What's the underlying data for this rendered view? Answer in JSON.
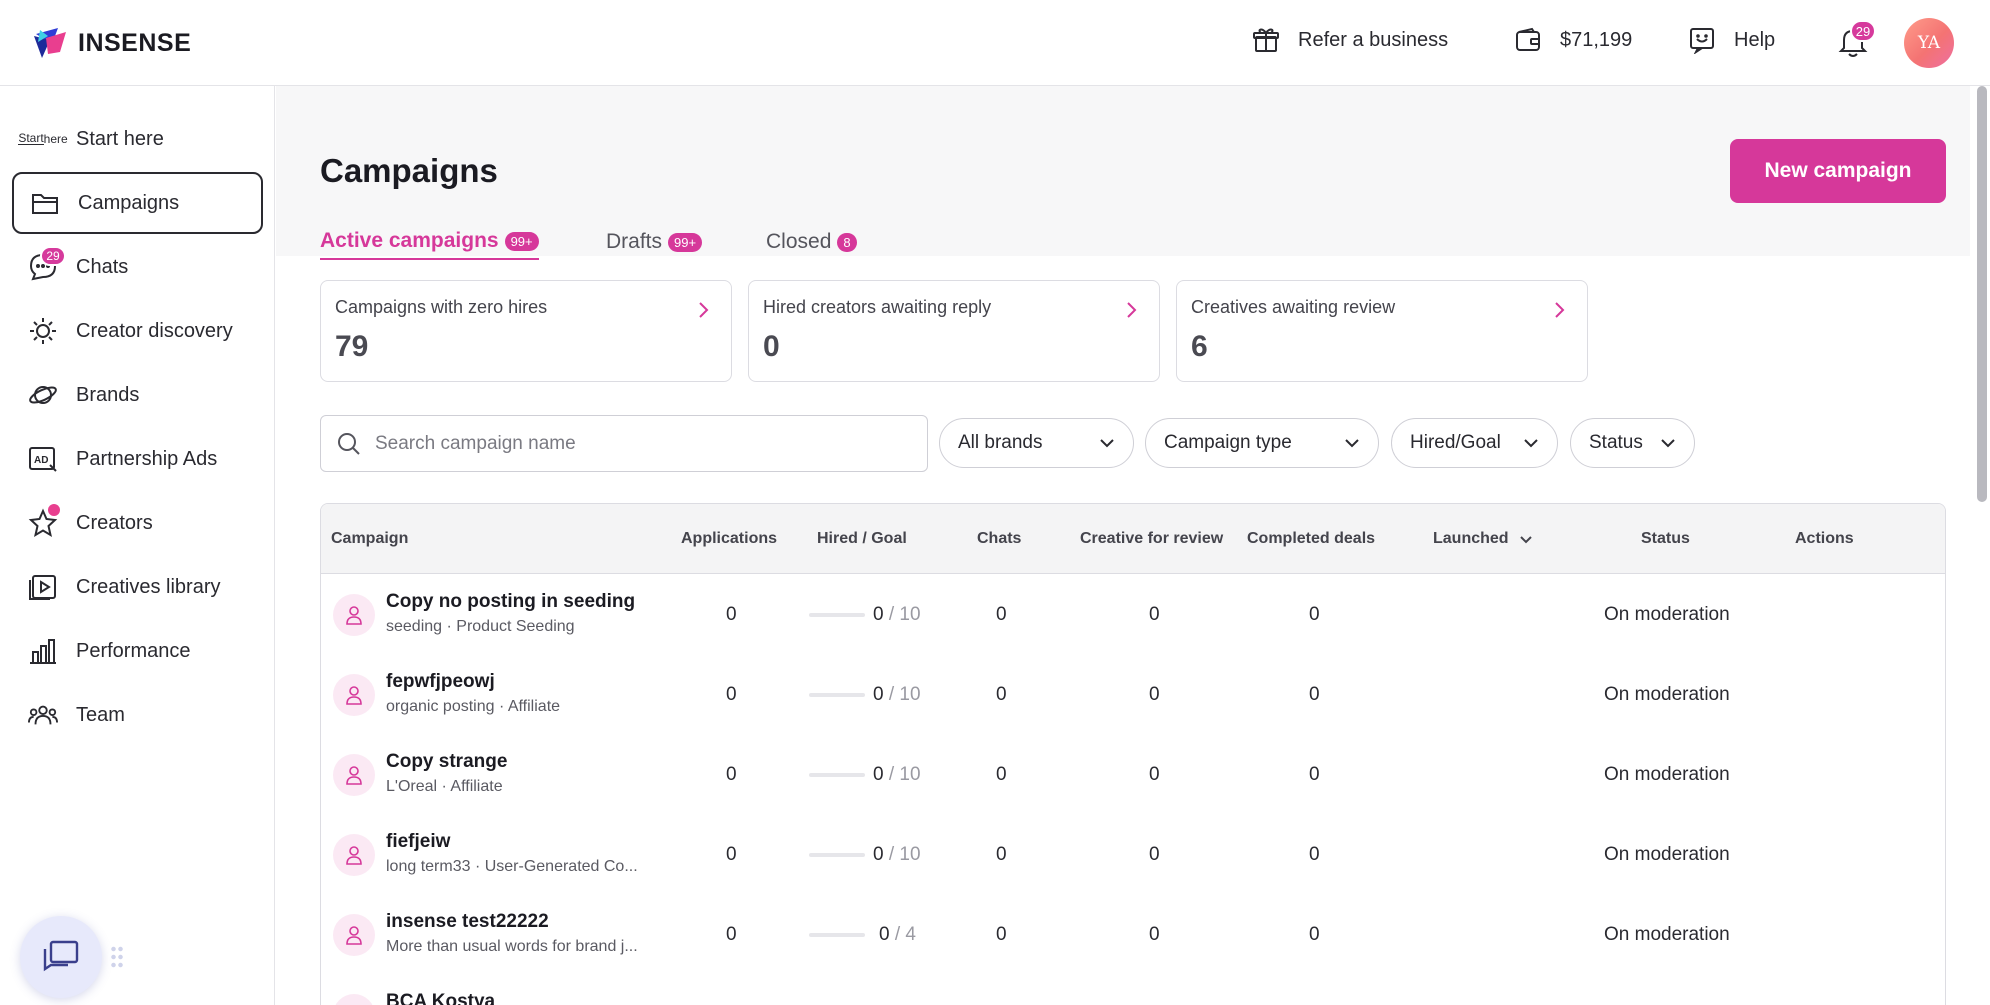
{
  "brand": {
    "name": "INSENSE"
  },
  "topbar": {
    "refer_label": "Refer a business",
    "balance": "$71,199",
    "help_label": "Help",
    "notification_count": "29",
    "avatar_initials": "YA"
  },
  "sidebar": {
    "start_icon_text": [
      "Start",
      "here"
    ],
    "items": [
      {
        "label": "Start here",
        "icon": "start-here-icon"
      },
      {
        "label": "Campaigns",
        "icon": "folder-icon",
        "active": true
      },
      {
        "label": "Chats",
        "icon": "chat-icon",
        "badge": "29"
      },
      {
        "label": "Creator discovery",
        "icon": "sparkle-search-icon"
      },
      {
        "label": "Brands",
        "icon": "planet-icon"
      },
      {
        "label": "Partnership Ads",
        "icon": "ad-icon"
      },
      {
        "label": "Creators",
        "icon": "star-icon",
        "dot": true
      },
      {
        "label": "Creatives library",
        "icon": "play-library-icon"
      },
      {
        "label": "Performance",
        "icon": "bar-chart-icon"
      },
      {
        "label": "Team",
        "icon": "team-icon"
      }
    ]
  },
  "main": {
    "title": "Campaigns",
    "new_campaign_label": "New campaign",
    "tabs": [
      {
        "label": "Active campaigns",
        "badge": "99+",
        "active": true
      },
      {
        "label": "Drafts",
        "badge": "99+"
      },
      {
        "label": "Closed",
        "badge": "8"
      }
    ],
    "stats": [
      {
        "label": "Campaigns with zero hires",
        "value": "79"
      },
      {
        "label": "Hired creators awaiting reply",
        "value": "0"
      },
      {
        "label": "Creatives awaiting review",
        "value": "6"
      }
    ],
    "search": {
      "placeholder": "Search campaign name"
    },
    "filters": [
      "All brands",
      "Campaign type",
      "Hired/Goal",
      "Status"
    ],
    "table": {
      "columns": [
        "Campaign",
        "Applications",
        "Hired / Goal",
        "Chats",
        "Creative for review",
        "Completed deals",
        "Launched",
        "Status",
        "Actions"
      ],
      "rows": [
        {
          "name": "Copy no posting in seeding",
          "sub": "seeding · Product Seeding",
          "applications": "0",
          "hired": "0",
          "goal": "10",
          "hired_fraction": 0,
          "chats": "0",
          "creative_review": "0",
          "completed": "0",
          "status": "On moderation"
        },
        {
          "name": "fepwfjpeowj",
          "sub": "organic posting · Affiliate",
          "applications": "0",
          "hired": "0",
          "goal": "10",
          "hired_fraction": 0,
          "chats": "0",
          "creative_review": "0",
          "completed": "0",
          "status": "On moderation"
        },
        {
          "name": "Copy strange",
          "sub": "L'Oreal · Affiliate",
          "applications": "0",
          "hired": "0",
          "goal": "10",
          "hired_fraction": 0,
          "chats": "0",
          "creative_review": "0",
          "completed": "0",
          "status": "On moderation"
        },
        {
          "name": "fiefjeiw",
          "sub": "long term33 · User-Generated Co...",
          "applications": "0",
          "hired": "0",
          "goal": "10",
          "hired_fraction": 0,
          "chats": "0",
          "creative_review": "0",
          "completed": "0",
          "status": "On moderation"
        },
        {
          "name": "insense test22222",
          "sub": "More than usual words for brand j...",
          "applications": "0",
          "hired": "0",
          "goal": "4",
          "hired_fraction": 0,
          "chats": "0",
          "creative_review": "0",
          "completed": "0",
          "status": "On moderation"
        },
        {
          "name": "BCA Kostya",
          "sub": "",
          "applications": "",
          "hired": "",
          "goal": "",
          "hired_fraction": 0,
          "chats": "",
          "creative_review": "",
          "completed": "",
          "status": ""
        }
      ]
    }
  },
  "colors": {
    "accent": "#d6389a",
    "badge": "#d63a9c",
    "border": "#dcdce2"
  }
}
